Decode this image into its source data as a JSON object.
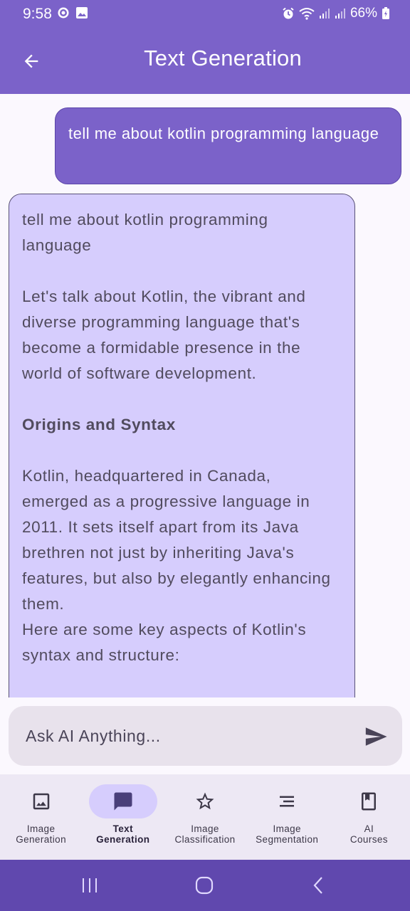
{
  "status_bar": {
    "time": "9:58",
    "battery": "66%"
  },
  "app_bar": {
    "title": "Text Generation"
  },
  "chat": {
    "user_message": "tell me about kotlin programming language",
    "ai_response": {
      "echo": "tell me about kotlin programming language",
      "intro": "Let's talk about Kotlin, the vibrant and diverse programming language that's become a formidable presence in the world of software development.",
      "heading": "Origins and Syntax",
      "para1": "Kotlin, headquartered in Canada, emerged as a progressive language in 2011. It sets itself apart from its Java brethren not just by inheriting Java's features, but also by elegantly enhancing them.",
      "para2": "Here are some key aspects of Kotlin's syntax and structure:"
    }
  },
  "input": {
    "placeholder": "Ask AI Anything..."
  },
  "bottom_nav": {
    "items": [
      {
        "label_line1": "Image",
        "label_line2": "Generation",
        "icon": "image-icon",
        "active": false
      },
      {
        "label_line1": "Text",
        "label_line2": "Generation",
        "icon": "chat-icon",
        "active": true
      },
      {
        "label_line1": "Image",
        "label_line2": "Classification",
        "icon": "star-icon",
        "active": false
      },
      {
        "label_line1": "Image",
        "label_line2": "Segmentation",
        "icon": "list-icon",
        "active": false
      },
      {
        "label_line1": "AI",
        "label_line2": "Courses",
        "icon": "book-icon",
        "active": false
      }
    ]
  },
  "colors": {
    "primary": "#7b62c9",
    "ai_bubble": "#d6cdfd",
    "system_nav": "#6048ae"
  }
}
